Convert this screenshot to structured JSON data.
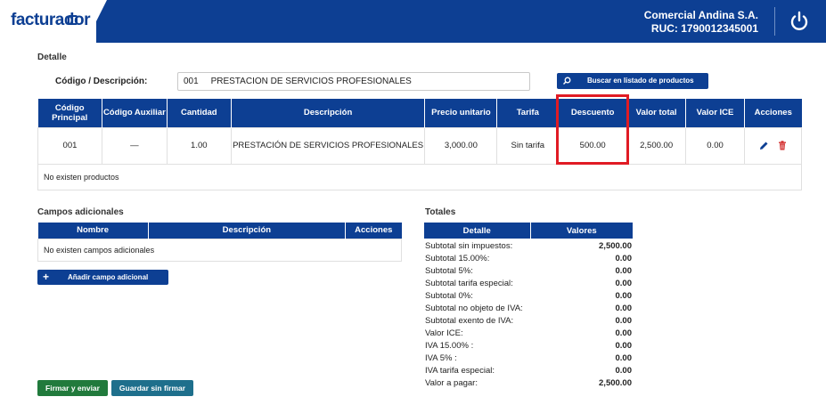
{
  "header": {
    "logo": "facturador",
    "company_name": "Comercial Andina S.A.",
    "ruc": "RUC: 1790012345001",
    "power_icon": "power-icon"
  },
  "detalle": {
    "title": "Detalle",
    "codigo_label": "Código / Descripción:",
    "codigo_value": "001     PRESTACIÓN DE SERVICIOS PROFESIONALES",
    "buscar_label": "Buscar en listado de productos",
    "columns": {
      "codigo_principal": "Código Principal",
      "codigo_auxiliar": "Código Auxiliar",
      "cantidad": "Cantidad",
      "descripcion": "Descripción",
      "precio_unitario": "Precio unitario",
      "tarifa": "Tarifa",
      "descuento": "Descuento",
      "valor_total": "Valor total",
      "valor_ice": "Valor ICE",
      "acciones": "Acciones"
    },
    "row": {
      "codigo_principal": "001",
      "codigo_auxiliar": "—",
      "cantidad": "1.00",
      "descripcion": "PRESTACIÓN DE SERVICIOS PROFESIONALES",
      "precio_unitario": "3,000.00",
      "tarifa": "Sin tarifa",
      "descuento": "500.00",
      "valor_total": "2,500.00",
      "valor_ice": "0.00"
    },
    "empty_text": "No existen productos"
  },
  "campos": {
    "title": "Campos adicionales",
    "col_nombre": "Nombre",
    "col_descripcion": "Descripción",
    "col_acciones": "Acciones",
    "empty_text": "No existen campos adicionales",
    "add_label": "Añadir campo adicional"
  },
  "totales": {
    "title": "Totales",
    "col_detalle": "Detalle",
    "col_valores": "Valores",
    "rows": [
      {
        "label": "Subtotal sin impuestos:",
        "value": "2,500.00"
      },
      {
        "label": "Subtotal 15.00%:",
        "value": "0.00"
      },
      {
        "label": "Subtotal 5%:",
        "value": "0.00"
      },
      {
        "label": "Subtotal tarifa especial:",
        "value": "0.00"
      },
      {
        "label": "Subtotal 0%:",
        "value": "0.00"
      },
      {
        "label": "Subtotal no objeto de IVA:",
        "value": "0.00"
      },
      {
        "label": "Subtotal exento de IVA:",
        "value": "0.00"
      },
      {
        "label": "Valor ICE:",
        "value": "0.00"
      },
      {
        "label": "IVA 15.00% :",
        "value": "0.00"
      },
      {
        "label": "IVA 5% :",
        "value": "0.00"
      },
      {
        "label": "IVA tarifa especial:",
        "value": "0.00"
      },
      {
        "label": "Valor a pagar:",
        "value": "2,500.00"
      }
    ]
  },
  "actions": {
    "firmar_label": "Firmar y enviar",
    "guardar_label": "Guardar sin firmar"
  },
  "colors": {
    "primary": "#0d3f93",
    "firmar": "#217a3c",
    "guardar": "#1e6f8c",
    "highlight": "#e01b24",
    "delete": "#d32f2f"
  }
}
